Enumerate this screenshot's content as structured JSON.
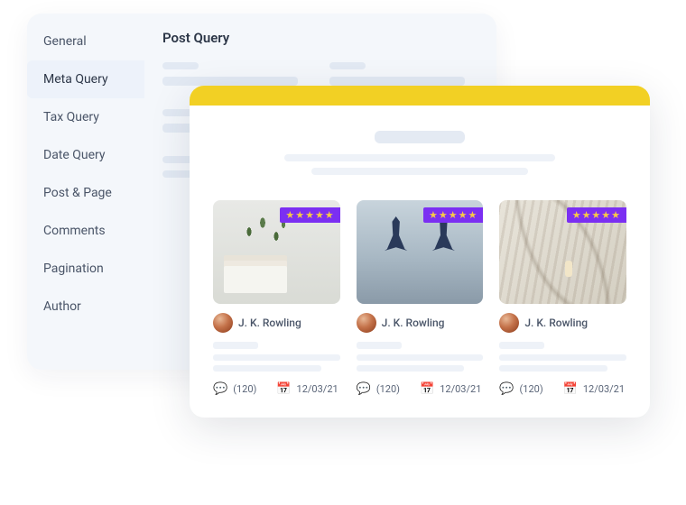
{
  "sidebar": {
    "items": [
      {
        "label": "General"
      },
      {
        "label": "Meta Query"
      },
      {
        "label": "Tax Query"
      },
      {
        "label": "Date Query"
      },
      {
        "label": "Post & Page"
      },
      {
        "label": "Comments"
      },
      {
        "label": "Pagination"
      },
      {
        "label": "Author"
      }
    ],
    "activeIndex": 1
  },
  "back": {
    "title": "Post Query"
  },
  "front": {
    "rating_stars": "★★★★★",
    "cards": [
      {
        "author": "J. K. Rowling",
        "comments": "(120)",
        "date": "12/03/21"
      },
      {
        "author": "J. K. Rowling",
        "comments": "(120)",
        "date": "12/03/21"
      },
      {
        "author": "J. K. Rowling",
        "comments": "(120)",
        "date": "12/03/21"
      }
    ]
  }
}
